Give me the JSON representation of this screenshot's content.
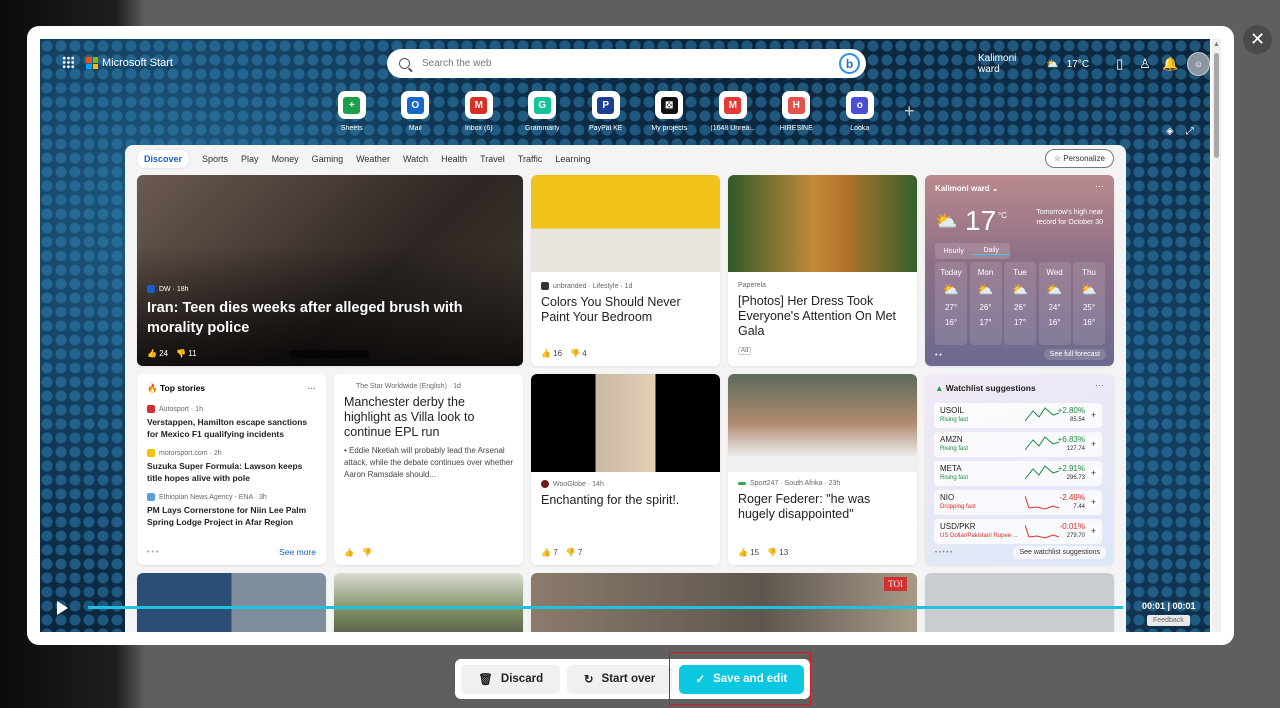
{
  "header": {
    "brand": "Microsoft Start",
    "search_placeholder": "Search the web",
    "location": "Kalimoni ward",
    "temp": "17°C"
  },
  "shortcuts": [
    {
      "label": "Sheets",
      "color": "#1e9e4a",
      "glyph": "+"
    },
    {
      "label": "Mail",
      "color": "#1769c9",
      "glyph": "O"
    },
    {
      "label": "Inbox (6)",
      "color": "#d93025",
      "glyph": "M"
    },
    {
      "label": "Grammarly",
      "color": "#15c39a",
      "glyph": "G"
    },
    {
      "label": "PayPal KE",
      "color": "#1d3f91",
      "glyph": "P"
    },
    {
      "label": "My projects",
      "color": "#111111",
      "glyph": "⊠"
    },
    {
      "label": "(1648 Unrea...",
      "color": "#e53935",
      "glyph": "M"
    },
    {
      "label": "HIRESINE",
      "color": "#e2534b",
      "glyph": "H"
    },
    {
      "label": "Looka",
      "color": "#4a4fd6",
      "glyph": "o"
    }
  ],
  "nav": {
    "tabs": [
      "Discover",
      "Sports",
      "Play",
      "Money",
      "Gaming",
      "Weather",
      "Watch",
      "Health",
      "Travel",
      "Traffic",
      "Learning"
    ],
    "personalize": "Personalize"
  },
  "hero": {
    "source": "DW · 18h",
    "title": "Iran: Teen dies weeks after alleged brush with morality police",
    "likes": "24",
    "dislikes": "11"
  },
  "card_colors": {
    "source": "unbranded · Lifestyle · 1d",
    "title": "Colors You Should Never Paint Your Bedroom",
    "likes": "16",
    "dislikes": "4"
  },
  "card_dress": {
    "source": "Paperela",
    "title": "[Photos] Her Dress Took Everyone's Attention On Met Gala",
    "badge": "Ad"
  },
  "weather": {
    "location": "Kalimoni ward",
    "temp": "17",
    "unit": "°C",
    "note": "Tomorrow's high near record for October 30",
    "tabs": [
      "Hourly",
      "Daily"
    ],
    "days": [
      {
        "d": "Today",
        "hi": "27°",
        "lo": "16°"
      },
      {
        "d": "Mon",
        "hi": "26°",
        "lo": "17°"
      },
      {
        "d": "Tue",
        "hi": "26°",
        "lo": "17°"
      },
      {
        "d": "Wed",
        "hi": "24°",
        "lo": "16°"
      },
      {
        "d": "Thu",
        "hi": "25°",
        "lo": "16°"
      }
    ],
    "link": "See full forecast"
  },
  "top_stories": {
    "title": "Top stories",
    "items": [
      {
        "source": "Autosport · 1h",
        "headline": "Verstappen, Hamilton escape sanctions for Mexico F1 qualifying incidents"
      },
      {
        "source": "motorsport.com · 2h",
        "headline": "Suzuka Super Formula: Lawson keeps title hopes alive with pole"
      },
      {
        "source": "Ethiopian News Agency - ENA · 3h",
        "headline": "PM Lays Cornerstone for Niin Lee Palm Spring Lodge Project in Afar Region"
      }
    ],
    "see_more": "See more"
  },
  "card_derby": {
    "source": "The Star Worldwide (English) · 1d",
    "title": "Manchester derby the highlight as Villa look to continue EPL run",
    "snippet": "• Eddie Nketiah will probably lead the Arsenal attack, while the debate continues over whether Aaron Ramsdale should..."
  },
  "card_spirit": {
    "source": "WooGlobe · 14h",
    "title": "Enchanting for the spirit!.",
    "likes": "7",
    "dislikes": "7"
  },
  "card_federer": {
    "source": "Sport247 · South Afrika · 23h",
    "title": "Roger Federer: \"he was hugely disappointed\"",
    "likes": "15",
    "dislikes": "13"
  },
  "watchlist": {
    "title": "Watchlist suggestions",
    "rows": [
      {
        "sym": "USOIL",
        "status": "Rising fast",
        "pct": "+2.80%",
        "val": "85.54",
        "up": true
      },
      {
        "sym": "AMZN",
        "status": "Rising fast",
        "pct": "+6.83%",
        "val": "127.74",
        "up": true
      },
      {
        "sym": "META",
        "status": "Rising fast",
        "pct": "+2.91%",
        "val": "296.73",
        "up": true
      },
      {
        "sym": "NIO",
        "status": "Dropping fast",
        "pct": "-2.49%",
        "val": "7.44",
        "up": false
      },
      {
        "sym": "USD/PKR",
        "status": "US Dollar/Pakistani Rupee ...",
        "pct": "-0.01%",
        "val": "279.70",
        "up": false
      }
    ],
    "link": "See watchlist suggestions"
  },
  "player": {
    "time": "00:01 | 00:01",
    "feedback": "Feedback"
  },
  "actions": {
    "discard": "Discard",
    "start_over": "Start over",
    "save": "Save and edit"
  }
}
